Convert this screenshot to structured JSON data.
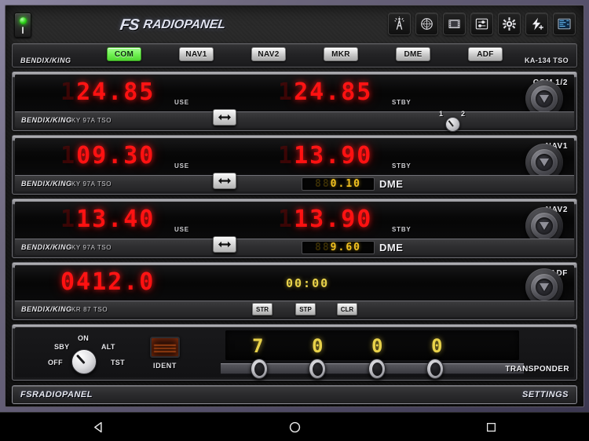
{
  "app": {
    "brand_fs": "FS",
    "brand_rp": "RADIOPANEL",
    "power_switch_mark": "I"
  },
  "toolbar": {
    "buttons": [
      {
        "name": "antenna-icon",
        "label": "Antenna"
      },
      {
        "name": "compass-icon",
        "label": "Compass"
      },
      {
        "name": "filmstrip-icon",
        "label": "Filmstrip"
      },
      {
        "name": "sliders-icon",
        "label": "Sliders"
      },
      {
        "name": "gear-icon",
        "label": "Settings"
      },
      {
        "name": "lightning-plus-icon",
        "label": "Add Preset"
      },
      {
        "name": "display-icon",
        "label": "Display"
      }
    ]
  },
  "tabstrip": {
    "brand": "BENDIX/KING",
    "model": "KA-134 TSO",
    "tabs": [
      {
        "label": "COM",
        "active": true
      },
      {
        "label": "NAV1",
        "active": false
      },
      {
        "label": "NAV2",
        "active": false
      },
      {
        "label": "MKR",
        "active": false
      },
      {
        "label": "DME",
        "active": false
      },
      {
        "label": "ADF",
        "active": false
      }
    ]
  },
  "com": {
    "unit_name": "COM 1/2",
    "brand": "BENDIX/KING",
    "model": "KY 97A TSO",
    "active_dim": "1",
    "active_freq": "24.85",
    "active_label": "USE",
    "standby_dim": "1",
    "standby_freq": "24.85",
    "standby_label": "STBY",
    "swap_icon": "◀▶",
    "selector_1": "1",
    "selector_2": "2"
  },
  "nav1": {
    "unit_name": "NAV1",
    "brand": "BENDIX/KING",
    "model": "KY 97A TSO",
    "active_dim": "1",
    "active_freq": "09.30",
    "active_label": "USE",
    "standby_dim": "1",
    "standby_freq": "13.90",
    "standby_label": "STBY",
    "swap_icon": "◀▶",
    "dme_dim": "88",
    "dme_value": "0.10",
    "dme_label": "DME"
  },
  "nav2": {
    "unit_name": "NAV2",
    "brand": "BENDIX/KING",
    "model": "KY 97A TSO",
    "active_dim": "1",
    "active_freq": "13.40",
    "active_label": "USE",
    "standby_dim": "1",
    "standby_freq": "13.90",
    "standby_label": "STBY",
    "swap_icon": "◀▶",
    "dme_dim": "88",
    "dme_value": "9.60",
    "dme_label": "DME"
  },
  "adf": {
    "unit_name": "ADF",
    "brand": "BENDIX/KING",
    "model": "KR 87 TSO",
    "frequency": "0412.0",
    "timer": "00:00",
    "buttons": [
      {
        "label": "STR"
      },
      {
        "label": "STP"
      },
      {
        "label": "CLR"
      }
    ]
  },
  "transponder": {
    "unit_name": "TRANSPONDER",
    "mode_labels": {
      "off": "OFF",
      "sby": "SBY",
      "on": "ON",
      "alt": "ALT",
      "tst": "TST"
    },
    "ident_label": "IDENT",
    "code_digits": [
      {
        "dim": "",
        "value": "7"
      },
      {
        "dim": "",
        "value": "0"
      },
      {
        "dim": "",
        "value": "0"
      },
      {
        "dim": "",
        "value": "0"
      }
    ]
  },
  "footer": {
    "left": "FSRADIOPANEL",
    "right": "SETTINGS"
  },
  "navbar": {
    "back": "back-icon",
    "home": "home-icon",
    "recents": "recents-icon"
  },
  "colors": {
    "led_green": "#2bd117",
    "seg_red": "#ff1111",
    "seg_amber": "#e8d24a",
    "tab_active": "#6ef050"
  }
}
